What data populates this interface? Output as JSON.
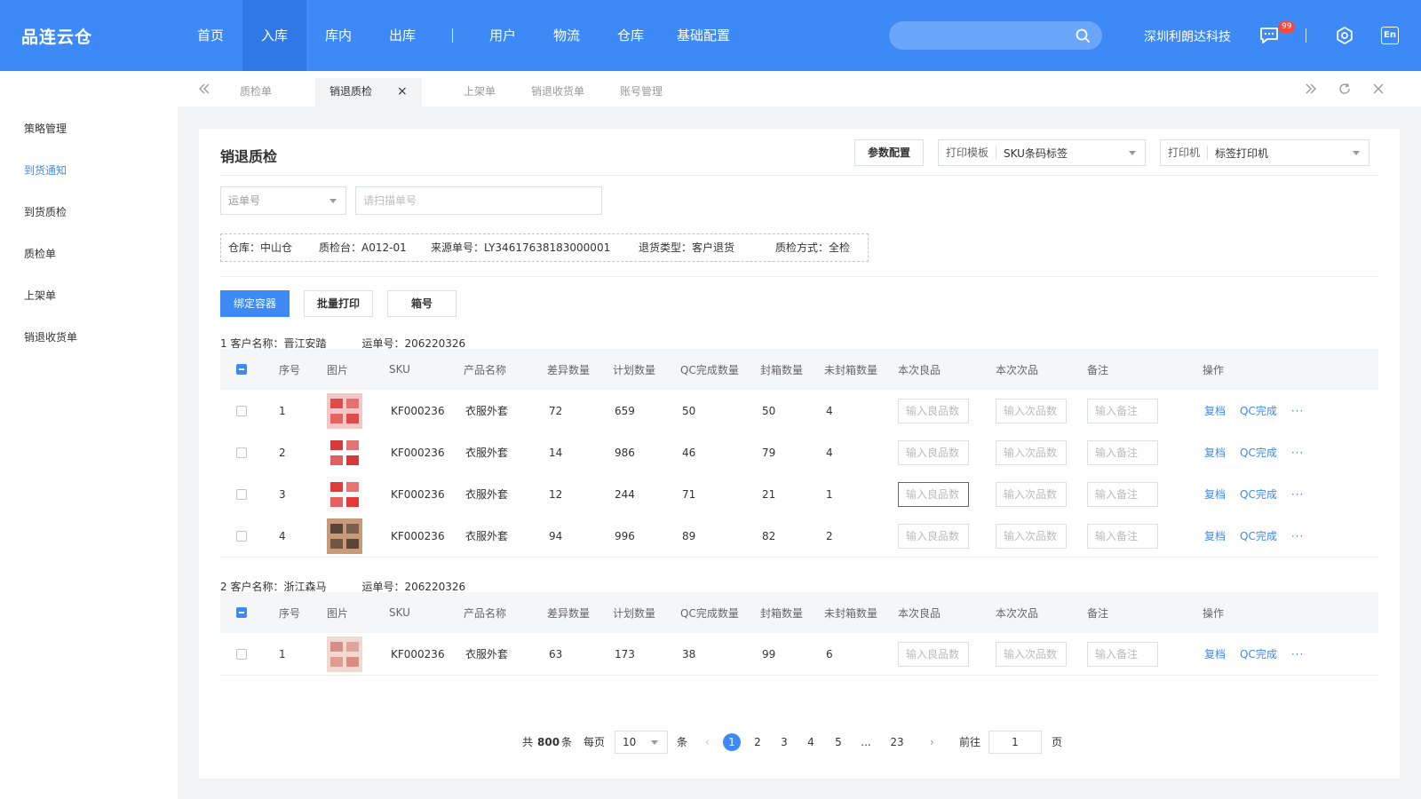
{
  "app": {
    "logo": "品连云仓",
    "company": "深圳利朗达科技",
    "msg_badge": "99",
    "lang": "En"
  },
  "nav": [
    "首页",
    "入库",
    "库内",
    "出库",
    "用户",
    "物流",
    "仓库",
    "基础配置"
  ],
  "sidebar": [
    "策略管理",
    "到货通知",
    "到货质检",
    "质检单",
    "上架单",
    "销退收货单"
  ],
  "tabs": [
    "质检单",
    "销退质检",
    "上架单",
    "销退收货单",
    "账号管理"
  ],
  "page": {
    "title": "销退质检",
    "param_btn": "参数配置",
    "print_template_label": "打印模板",
    "print_template_value": "SKU条码标签",
    "printer_label": "打印机",
    "printer_value": "标签打印机",
    "waybill_select": "运单号",
    "scan_placeholder": "请扫描单号"
  },
  "info": {
    "warehouse": "仓库：中山仓",
    "station": "质检台：A012-01",
    "source": "来源单号：LY34617638183000001",
    "return_type": "退货类型：客户退货",
    "qc_mode": "质检方式：全检"
  },
  "actions": {
    "bind": "绑定容器",
    "batch_print": "批量打印",
    "box": "箱号"
  },
  "columns": [
    "序号",
    "图片",
    "SKU",
    "产品名称",
    "差异数量",
    "计划数量",
    "QC完成数量",
    "封箱数量",
    "未封箱数量",
    "本次良品",
    "本次次品",
    "备注",
    "操作"
  ],
  "placeholders": {
    "good": "输入良品数",
    "bad": "输入次品数",
    "note": "输入备注"
  },
  "ops": {
    "recheck": "复档",
    "qc_done": "QC完成",
    "more": "···"
  },
  "groups": [
    {
      "title": "1  客户名称：晋江安踏",
      "waybill": "运单号：206220326",
      "rows": [
        {
          "no": "1",
          "sku": "KF000236",
          "name": "衣服外套",
          "diff": "72",
          "plan": "659",
          "qc": "50",
          "sealed": "50",
          "unsealed": "4"
        },
        {
          "no": "2",
          "sku": "KF000236",
          "name": "衣服外套",
          "diff": "14",
          "plan": "986",
          "qc": "46",
          "sealed": "79",
          "unsealed": "4"
        },
        {
          "no": "3",
          "sku": "KF000236",
          "name": "衣服外套",
          "diff": "12",
          "plan": "244",
          "qc": "71",
          "sealed": "21",
          "unsealed": "1"
        },
        {
          "no": "4",
          "sku": "KF000236",
          "name": "衣服外套",
          "diff": "94",
          "plan": "996",
          "qc": "89",
          "sealed": "82",
          "unsealed": "2"
        }
      ]
    },
    {
      "title": "2  客户名称：浙江森马",
      "waybill": "运单号：206220326",
      "rows": [
        {
          "no": "1",
          "sku": "KF000236",
          "name": "衣服外套",
          "diff": "63",
          "plan": "173",
          "qc": "38",
          "sealed": "99",
          "unsealed": "6"
        }
      ]
    }
  ],
  "pager": {
    "total_prefix": "共",
    "total": "800",
    "total_suffix": "条",
    "per_page_label": "每页",
    "per_page": "10",
    "per_page_unit": "条",
    "pages": [
      "1",
      "2",
      "3",
      "4",
      "5",
      "...",
      "23"
    ],
    "goto_label": "前往",
    "goto_value": "1",
    "goto_unit": "页"
  }
}
